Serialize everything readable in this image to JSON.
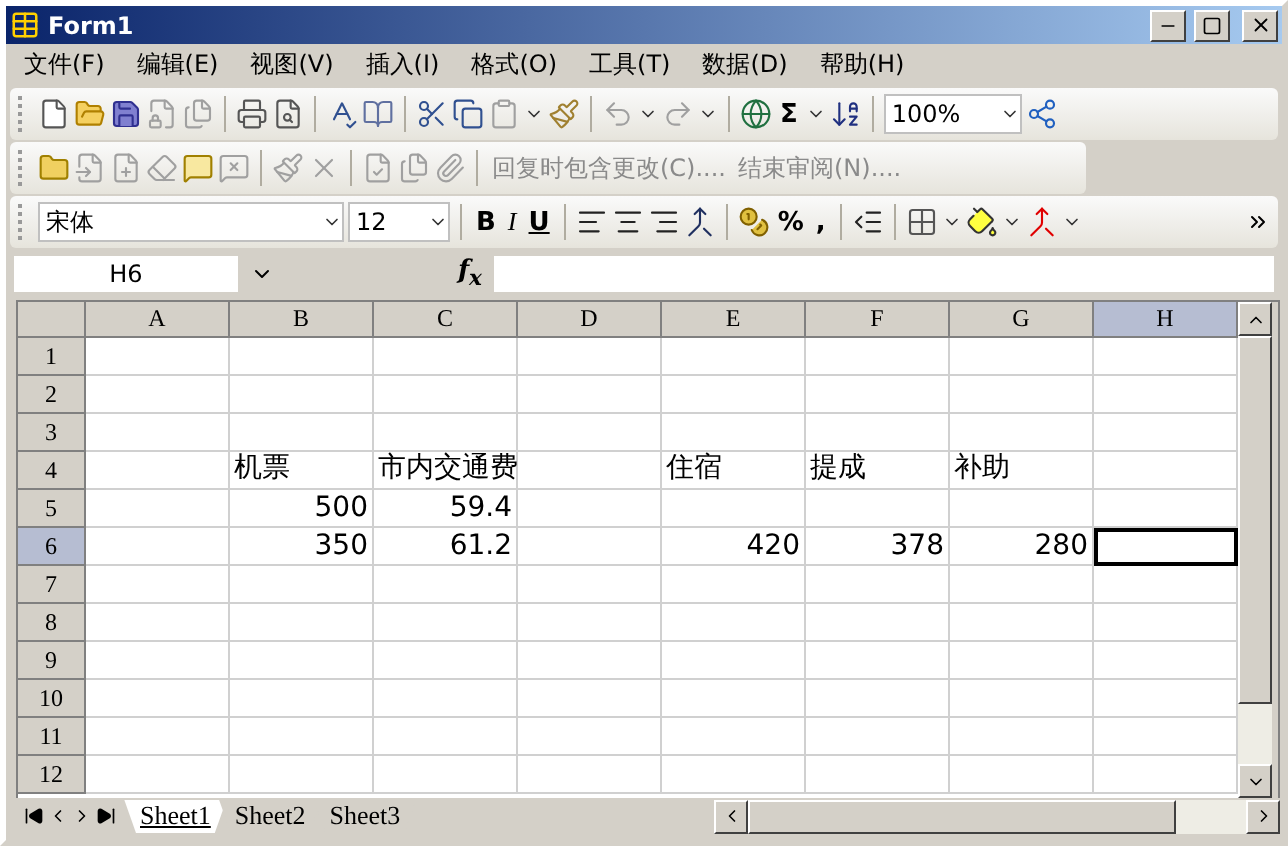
{
  "window": {
    "title": "Form1"
  },
  "menu": [
    "文件(F)",
    "编辑(E)",
    "视图(V)",
    "插入(I)",
    "格式(O)",
    "工具(T)",
    "数据(D)",
    "帮助(H)"
  ],
  "standard_toolbar": {
    "sum": "Σ",
    "zoom": "100%"
  },
  "reviewing_toolbar": {
    "buttons": [
      {
        "label": "回复时包含更改(C)....",
        "disabled": true
      },
      {
        "label": "结束审阅(N)....",
        "disabled": true
      }
    ]
  },
  "formatting_toolbar": {
    "font": "宋体",
    "size": "12",
    "bold": "B",
    "italic": "I",
    "underline": "U",
    "percent": "%",
    "comma": ","
  },
  "formula_bar": {
    "name_box": "H6",
    "fx": "f$_{x}$"
  },
  "grid": {
    "columns": [
      {
        "label": "A",
        "selected": false
      },
      {
        "label": "B",
        "selected": false
      },
      {
        "label": "C",
        "selected": false
      },
      {
        "label": "D",
        "selected": false
      },
      {
        "label": "E",
        "selected": false
      },
      {
        "label": "F",
        "selected": false
      },
      {
        "label": "G",
        "selected": false
      },
      {
        "label": "H",
        "selected": true
      }
    ],
    "rows": [
      {
        "label": "1",
        "selected": false,
        "cells": [
          null,
          null,
          null,
          null,
          null,
          null,
          null,
          null
        ]
      },
      {
        "label": "2",
        "selected": false,
        "cells": [
          null,
          null,
          null,
          null,
          null,
          null,
          null,
          null
        ]
      },
      {
        "label": "3",
        "selected": false,
        "cells": [
          null,
          null,
          null,
          null,
          null,
          null,
          null,
          null
        ]
      },
      {
        "label": "4",
        "selected": false,
        "cells": [
          null,
          {
            "text": "机票",
            "kind": "text"
          },
          {
            "text": "市内交通费",
            "kind": "text"
          },
          null,
          {
            "text": "住宿",
            "kind": "text"
          },
          {
            "text": "提成",
            "kind": "text"
          },
          {
            "text": "补助",
            "kind": "text"
          },
          null
        ]
      },
      {
        "label": "5",
        "selected": false,
        "cells": [
          null,
          {
            "text": "500",
            "kind": "number"
          },
          {
            "text": "59.4",
            "kind": "number"
          },
          null,
          null,
          null,
          null,
          null
        ]
      },
      {
        "label": "6",
        "selected": true,
        "cells": [
          null,
          {
            "text": "350",
            "kind": "number"
          },
          {
            "text": "61.2",
            "kind": "number"
          },
          null,
          {
            "text": "420",
            "kind": "number"
          },
          {
            "text": "378",
            "kind": "number"
          },
          {
            "text": "280",
            "kind": "number"
          },
          {
            "selected": true
          }
        ]
      },
      {
        "label": "7",
        "selected": false,
        "cells": [
          null,
          null,
          null,
          null,
          null,
          null,
          null,
          null
        ]
      },
      {
        "label": "8",
        "selected": false,
        "cells": [
          null,
          null,
          null,
          null,
          null,
          null,
          null,
          null
        ]
      },
      {
        "label": "9",
        "selected": false,
        "cells": [
          null,
          null,
          null,
          null,
          null,
          null,
          null,
          null
        ]
      },
      {
        "label": "10",
        "selected": false,
        "cells": [
          null,
          null,
          null,
          null,
          null,
          null,
          null,
          null
        ]
      },
      {
        "label": "11",
        "selected": false,
        "cells": [
          null,
          null,
          null,
          null,
          null,
          null,
          null,
          null
        ]
      },
      {
        "label": "12",
        "selected": false,
        "cells": [
          null,
          null,
          null,
          null,
          null,
          null,
          null,
          null
        ]
      }
    ]
  },
  "sheet_tabs": [
    {
      "label": "Sheet1",
      "selected": true
    },
    {
      "label": "Sheet2",
      "selected": false
    },
    {
      "label": "Sheet3",
      "selected": false
    }
  ]
}
